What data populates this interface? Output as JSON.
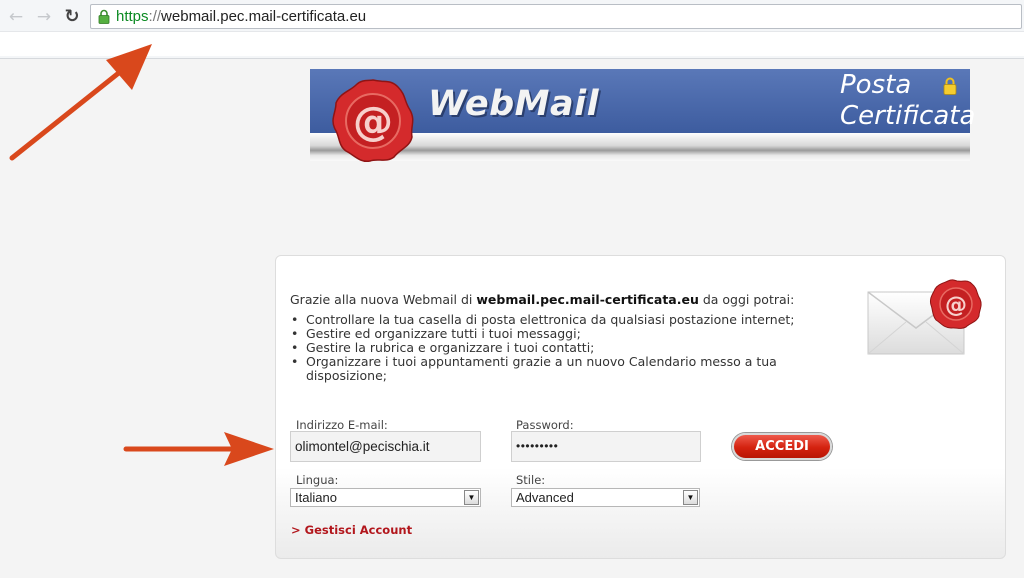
{
  "browser": {
    "back_icon": "arrow-left-icon",
    "forward_icon": "arrow-right-icon",
    "reload_icon": "reload-icon",
    "url_protocol": "https",
    "url_separator": "://",
    "url_host": "webmail.pec.mail-certificata.eu"
  },
  "banner": {
    "brand": "WebMail",
    "tagline_line1": "Posta",
    "tagline_line2": "Certificata",
    "seal_glyph": "@",
    "blue": "#4a68ab",
    "seal_color": "#d42a2c"
  },
  "intro": {
    "prefix": "Grazie alla nuova Webmail di ",
    "domain": "webmail.pec.mail-certificata.eu",
    "suffix": " da oggi potrai:"
  },
  "features": [
    "Controllare la tua casella di posta elettronica da qualsiasi postazione internet;",
    "Gestire ed organizzare tutti i tuoi messaggi;",
    "Gestire la rubrica e organizzare i tuoi contatti;",
    "Organizzare i tuoi appuntamenti grazie a un nuovo Calendario messo a tua disposizione;"
  ],
  "form": {
    "email_label": "Indirizzo E-mail:",
    "email_value": "olimontel@pecischia.it",
    "password_label": "Password:",
    "password_value": "•••••••••",
    "language_label": "Lingua:",
    "language_value": "Italiano",
    "style_label": "Stile:",
    "style_value": "Advanced",
    "submit_label": "ACCEDI",
    "manage_link": "> Gestisci Account"
  },
  "colors": {
    "accent_red": "#d4220f",
    "arrow": "#d9481c",
    "link_red": "#b2161c"
  }
}
